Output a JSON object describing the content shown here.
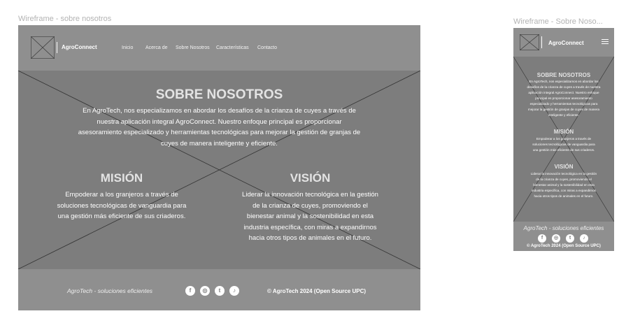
{
  "desktop": {
    "frame_label": "Wireframe - sobre nosotros",
    "brand": "AgroConnect",
    "nav": [
      "Inicio",
      "Acerca de",
      "Sobre Nosotros",
      "Características",
      "Contacto"
    ],
    "about_title": "SOBRE NOSOTROS",
    "about_lines": [
      "En AgroTech, nos especializamos en abordar los desafíos de la crianza de cuyes a través de",
      "nuestra aplicación integral AgroConnect. Nuestro enfoque principal es proporcionar",
      "asesoramiento especializado y herramientas tecnológicas para mejorar la gestión de granjas de",
      "cuyes de manera inteligente y eficiente."
    ],
    "mision_title": "MISIÓN",
    "mision_lines": [
      "Empoderar a los granjeros a través de",
      "soluciones tecnológicas de vanguardia para",
      "una gestión más eficiente de sus criaderos."
    ],
    "vision_title": "VISIÓN",
    "vision_lines": [
      "Liderar la innovación tecnológica en la gestión",
      "de la crianza de cuyes, promoviendo el",
      "bienestar animal y la sostenibilidad en esta",
      "industria específica, con miras a expandirnos",
      "hacia otros tipos de animales en el futuro."
    ],
    "footer_tagline": "AgroTech - soluciones eficientes",
    "footer_copyright": "© AgroTech 2024 (Open Source UPC)"
  },
  "mobile": {
    "frame_label": "Wireframe - Sobre Noso...",
    "brand": "AgroConnect",
    "about_title": "SOBRE NOSOTROS",
    "about_lines": [
      "En AgroTech, nos especializamos en abordar los",
      "desafíos de la crianza de cuyes a través de nuestra",
      "aplicación integral AgroConnect. Nuestro enfoque",
      "principal es proporcionar asesoramiento",
      "especializado y herramientas tecnológicas para",
      "mejorar la gestión de granjas de cuyes de manera",
      "inteligente y eficiente."
    ],
    "mision_title": "MISIÓN",
    "mision_lines": [
      "Empoderar a los granjeros a través de",
      "soluciones tecnológicas de vanguardia para",
      "una gestión más eficiente de sus criaderos."
    ],
    "vision_title": "VISIÓN",
    "vision_lines": [
      "Liderar la innovación tecnológica en la gestión",
      "de la crianza de cuyes, promoviendo el",
      "bienestar animal y la sostenibilidad en esta",
      "industria específica, con miras a expandirnos",
      "hacia otros tipos de animales en el futuro."
    ],
    "footer_tagline": "AgroTech - soluciones eficientes",
    "footer_copyright": "© AgroTech 2024 (Open Source UPC)"
  },
  "icons": [
    "facebook-icon",
    "instagram-icon",
    "twitter-icon",
    "tiktok-icon"
  ],
  "colors": {
    "frame": "#8f8f8f",
    "hero": "#7d7d7d",
    "text": "#ffffff",
    "title": "#e3e3e3",
    "label": "#b3b3b3"
  }
}
